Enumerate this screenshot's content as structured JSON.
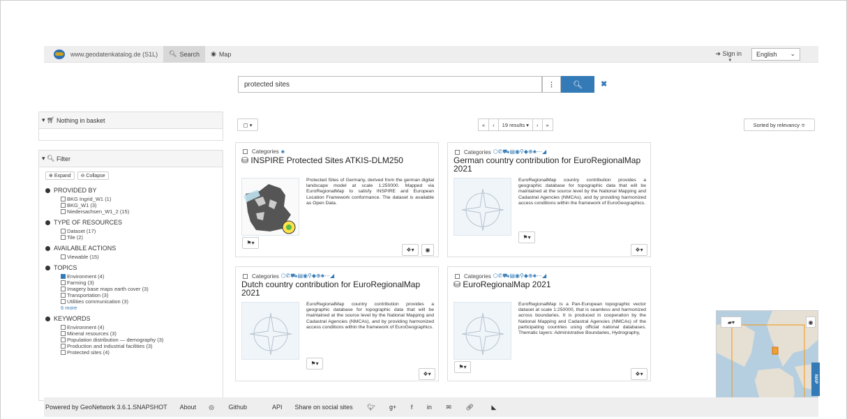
{
  "nav": {
    "site": "www.geodatenkatalog.de (S1L)",
    "search_label": "Search",
    "map_label": "Map",
    "signin_label": "Sign in",
    "language": "English"
  },
  "search": {
    "query": "protected sites"
  },
  "basket": {
    "label": "Nothing in basket"
  },
  "filter": {
    "title": "Filter",
    "expand_label": "Expand",
    "collapse_label": "Collapse",
    "sections": [
      {
        "title": "PROVIDED BY",
        "items": [
          {
            "label": "BKG Ingrid_W1 (1)",
            "checked": false
          },
          {
            "label": "BKG_W1 (3)",
            "checked": false
          },
          {
            "label": "Niedersachsen_W1_2 (15)",
            "checked": false
          }
        ]
      },
      {
        "title": "TYPE OF RESOURCES",
        "items": [
          {
            "label": "Dataset (17)",
            "checked": false
          },
          {
            "label": "Tile (2)",
            "checked": false
          }
        ]
      },
      {
        "title": "AVAILABLE ACTIONS",
        "items": [
          {
            "label": "Viewable (15)",
            "checked": false
          }
        ]
      },
      {
        "title": "TOPICS",
        "items": [
          {
            "label": "Environment (4)",
            "checked": true
          },
          {
            "label": "Farming (3)",
            "checked": false
          },
          {
            "label": "Imagery base maps earth cover (3)",
            "checked": false
          },
          {
            "label": "Transportation (3)",
            "checked": false
          },
          {
            "label": "Utilities communication (3)",
            "checked": false
          }
        ],
        "more": "6  more"
      },
      {
        "title": "KEYWORDS",
        "items": [
          {
            "label": "Environment (4)",
            "checked": false
          },
          {
            "label": "Mineral resources (3)",
            "checked": false
          },
          {
            "label": "Population distribution — demography (3)",
            "checked": false
          },
          {
            "label": "Production and industrial facilities (3)",
            "checked": false
          },
          {
            "label": "Protected sites (4)",
            "checked": false
          }
        ]
      }
    ]
  },
  "results": {
    "pager_first": "«",
    "pager_prev": "‹",
    "count_label": "19 results ▾",
    "pager_next": "›",
    "pager_last": "»",
    "sort_label": "Sorted by relevancy ≑",
    "select_label": "▢ ▾"
  },
  "cards": [
    {
      "categories": "Categories",
      "icons": "♣",
      "title": "INSPIRE Protected Sites ATKIS-DLM250",
      "description": "Protected Sites of Germany, derived from the german digital landscape model at scale 1:250000. Mapped via EuroRegionalMap to satisfy INSPIRE and European Location Framework conformance. The dataset is available as Open Data."
    },
    {
      "categories": "Categories",
      "icons": "⬡✆⛟▤◉⚲◆⊕♣⋯◢",
      "title": "German country contribution for EuroRegionalMap 2021",
      "description": "EuroRegionalMap country contribution provides a geographic database for topographic data that will be maintained at the source level by the National Mapping and Cadastral Agencies (NMCAs), and by providing harmonized access conditions within the framework of EuroGeographics."
    },
    {
      "categories": "Categories",
      "icons": "⬡✆⛟▤◉⚲◆⊕♣⋯◢",
      "title": "Dutch country contribution for EuroRegionalMap 2021",
      "description": "EuroRegionalMap country contribution provides a geographic database for topographic data that will be maintained at the source level by the National Mapping and Cadastral Agencies (NMCAs), and by providing harmonized access conditions within the framework of EuroGeographics."
    },
    {
      "categories": "Categories",
      "icons": "⬡✆⛟▤◉⚲◆⊕♣⋯◢",
      "title": "EuroRegionalMap 2021",
      "description": "EuroRegionalMap is a Pan-European topographic vector dataset at scale 1:250000, that is seamless and harmonized across boundaries. It is produced in cooperation by the National Mapping and Cadastral Agencies (NMCAs) of the participating countries using official national databases. Thematic layers: Administrative Boundaries, Hydrography,"
    }
  ],
  "footer": {
    "powered": "Powered by GeoNetwork 3.6.1.SNAPSHOT",
    "about": "About",
    "github": "Github",
    "api": "API",
    "share": "Share on social sites"
  },
  "map": {
    "tab_label": "MAP"
  },
  "colors": {
    "accent": "#337ab7"
  }
}
